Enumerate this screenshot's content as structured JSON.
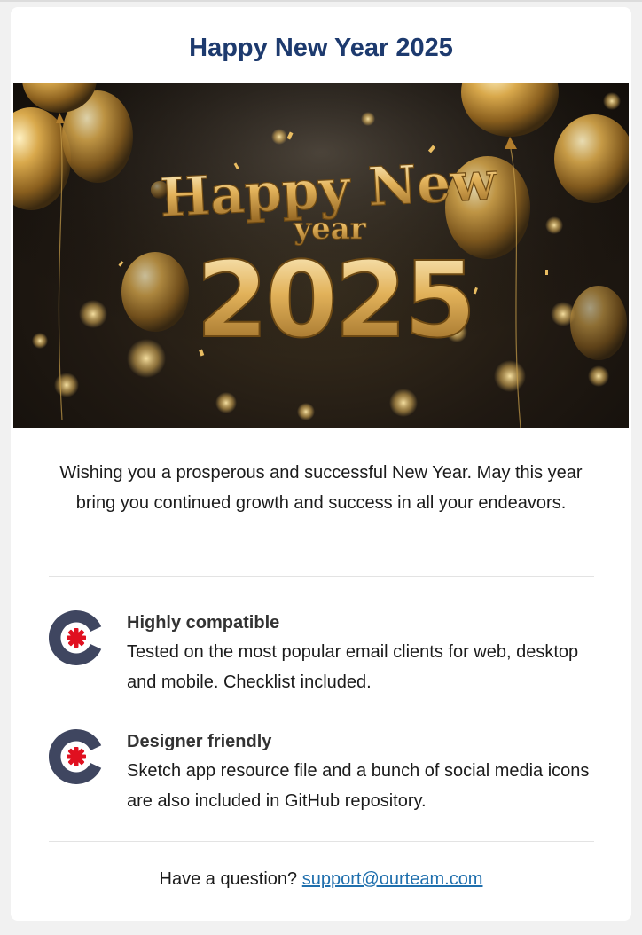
{
  "email": {
    "title": "Happy New Year 2025",
    "hero": {
      "line1": "Happy New",
      "line2": "year",
      "line3": "2025"
    },
    "intro": "Wishing you a prosperous and successful New Year. May this year bring you continued growth and success in all your endeavors.",
    "features": [
      {
        "title": "Highly compatible",
        "text": "Tested on the most popular email clients for web, desktop and mobile. Checklist included.",
        "icon": "gear-logo-icon"
      },
      {
        "title": "Designer friendly",
        "text": "Sketch app resource file and a bunch of social media icons are also included in GitHub repository.",
        "icon": "gear-logo-icon"
      }
    ],
    "footer": {
      "question": "Have a question?",
      "link_text": "support@ourteam.com"
    },
    "colors": {
      "title": "#1d3a6e",
      "icon_ring": "#3f4660",
      "icon_center": "#e01020",
      "link": "#1f6fad",
      "gold": "#d4a64a"
    }
  }
}
